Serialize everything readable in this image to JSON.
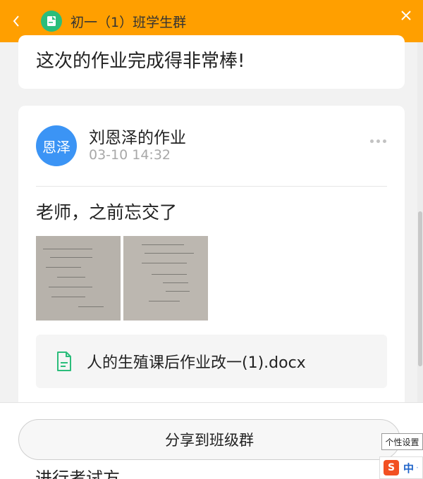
{
  "header": {
    "title": "初一（1）班学生群",
    "back_icon": "chevron-left-icon",
    "app_icon": "note-edit-icon",
    "close_icon": "close-icon",
    "background": "#ff9f00"
  },
  "top_card": {
    "message": "这次的作业完成得非常棒!"
  },
  "post": {
    "avatar_text": "恩泽",
    "avatar_color": "#3b94f5",
    "title": "刘恩泽的作业",
    "time": "03-10 14:32",
    "body": "老师，之前忘交了",
    "images": [
      "homework-photo-1",
      "homework-photo-2"
    ],
    "attachment": {
      "icon": "document-icon",
      "name": "人的生殖课后作业改一(1).docx"
    }
  },
  "footer": {
    "share_label": "分享到班级群",
    "partial_text": "进行考试方"
  },
  "overlay": {
    "tooltip": "个性设置",
    "ime_logo": "S",
    "ime_mode": "中",
    "ime_extra": "·"
  }
}
